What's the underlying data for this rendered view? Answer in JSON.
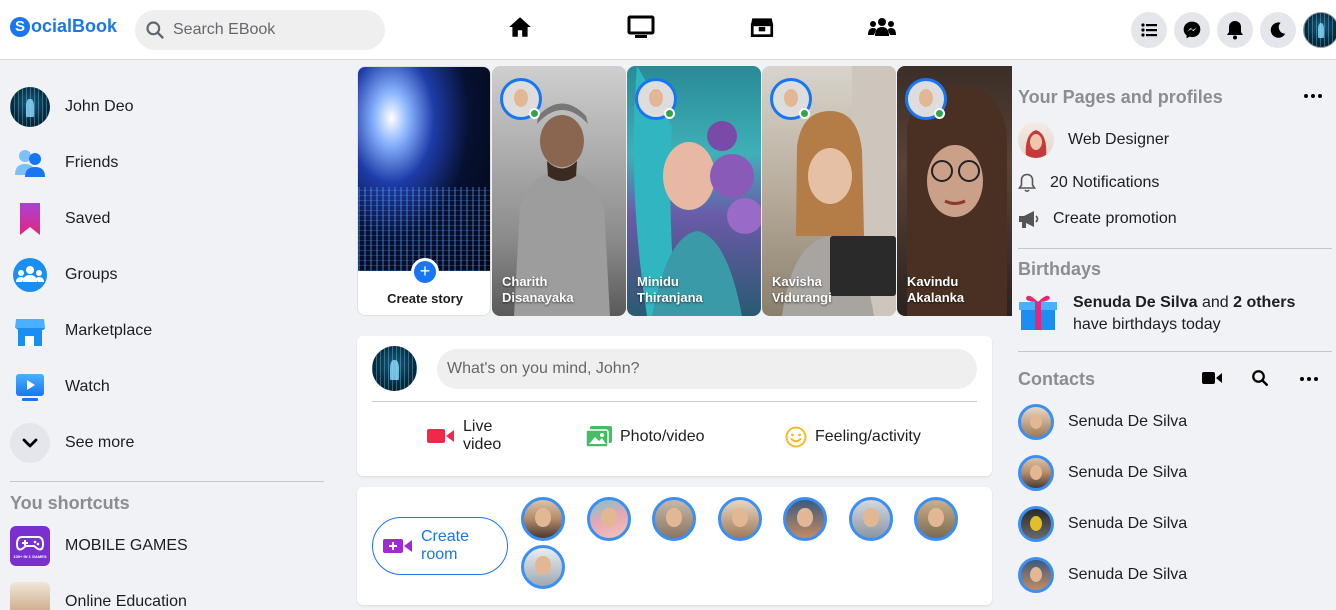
{
  "app": {
    "logo_text": "ocialBook",
    "logo_letter": "S",
    "search_placeholder": "Search EBook"
  },
  "sidebar": {
    "items": [
      {
        "label": "John Deo",
        "icon": "avatar"
      },
      {
        "label": "Friends",
        "icon": "friends-icon"
      },
      {
        "label": "Saved",
        "icon": "bookmark-icon"
      },
      {
        "label": "Groups",
        "icon": "groups-icon"
      },
      {
        "label": "Marketplace",
        "icon": "marketplace-icon"
      },
      {
        "label": "Watch",
        "icon": "watch-icon"
      },
      {
        "label": "See more",
        "icon": "chevron-down-icon"
      }
    ],
    "shortcuts_title": "You shortcuts",
    "shortcuts": [
      {
        "label": "MOBILE GAMES",
        "icon_text": "100+ IN 1 GAMES"
      },
      {
        "label": "Online Education"
      }
    ]
  },
  "stories": {
    "create_label": "Create story",
    "plus": "+",
    "items": [
      {
        "name_line1": "Charith",
        "name_line2": "Disanayaka"
      },
      {
        "name_line1": "Minidu",
        "name_line2": "Thiranjana"
      },
      {
        "name_line1": "Kavisha",
        "name_line2": "Vidurangi"
      },
      {
        "name_line1": "Kavindu",
        "name_line2": "Akalanka"
      }
    ]
  },
  "composer": {
    "placeholder": "What's on you mind, John?",
    "actions": [
      {
        "line1": "Live",
        "line2": "video",
        "color": "#f02849"
      },
      {
        "label": "Photo/video",
        "color": "#45bd62"
      },
      {
        "label": "Feeling/activity",
        "color": "#f7b928"
      }
    ]
  },
  "rooms": {
    "create_line1": "Create",
    "create_line2": "room"
  },
  "right": {
    "pages_title": "Your Pages and profiles",
    "page_name": "Web Designer",
    "notifications": "20 Notifications",
    "promotion": "Create promotion",
    "birthdays_title": "Birthdays",
    "birthday_name": "Senuda De Silva",
    "birthday_and": "and",
    "birthday_others": "2 others",
    "birthday_text": "have birthdays today",
    "contacts_title": "Contacts",
    "contacts": [
      {
        "name": "Senuda De Silva"
      },
      {
        "name": "Senuda De Silva"
      },
      {
        "name": "Senuda De Silva"
      },
      {
        "name": "Senuda De Silva"
      }
    ]
  },
  "colors": {
    "accent": "#1876f2",
    "online": "#31a24c",
    "live": "#f02849",
    "photo": "#45bd62",
    "feeling": "#f7b928"
  }
}
